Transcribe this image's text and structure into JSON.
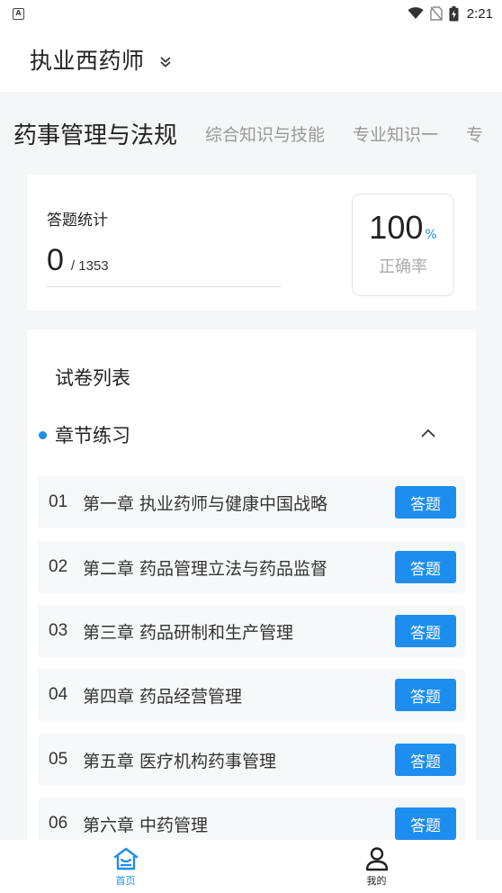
{
  "status_bar": {
    "time": "2:21",
    "notification_icon": "A"
  },
  "header": {
    "title": "执业西药师"
  },
  "tabs": [
    {
      "label": "药事管理与法规",
      "active": true
    },
    {
      "label": "综合知识与技能",
      "active": false
    },
    {
      "label": "专业知识一",
      "active": false
    },
    {
      "label": "专",
      "active": false
    }
  ],
  "stats": {
    "label": "答题统计",
    "answered": "0",
    "total": "/ 1353",
    "accuracy_value": "100",
    "accuracy_unit": "%",
    "accuracy_label": "正确率"
  },
  "exam_list": {
    "title": "试卷列表",
    "section_label": "章节练习",
    "button_label": "答题",
    "chapters": [
      {
        "num": "01",
        "title": "第一章 执业药师与健康中国战略"
      },
      {
        "num": "02",
        "title": "第二章 药品管理立法与药品监督"
      },
      {
        "num": "03",
        "title": "第三章 药品研制和生产管理"
      },
      {
        "num": "04",
        "title": "第四章 药品经营管理"
      },
      {
        "num": "05",
        "title": "第五章 医疗机构药事管理"
      },
      {
        "num": "06",
        "title": "第六章 中药管理"
      }
    ]
  },
  "bottom_nav": {
    "home_label": "首页",
    "mine_label": "我的"
  },
  "colors": {
    "accent": "#1e8df0",
    "background": "#f5f6f8",
    "card": "#ffffff"
  },
  "icons": [
    "wifi-icon",
    "no-sim-icon",
    "battery-icon",
    "chevron-down-icon",
    "chevron-up-icon",
    "home-icon",
    "user-icon"
  ]
}
